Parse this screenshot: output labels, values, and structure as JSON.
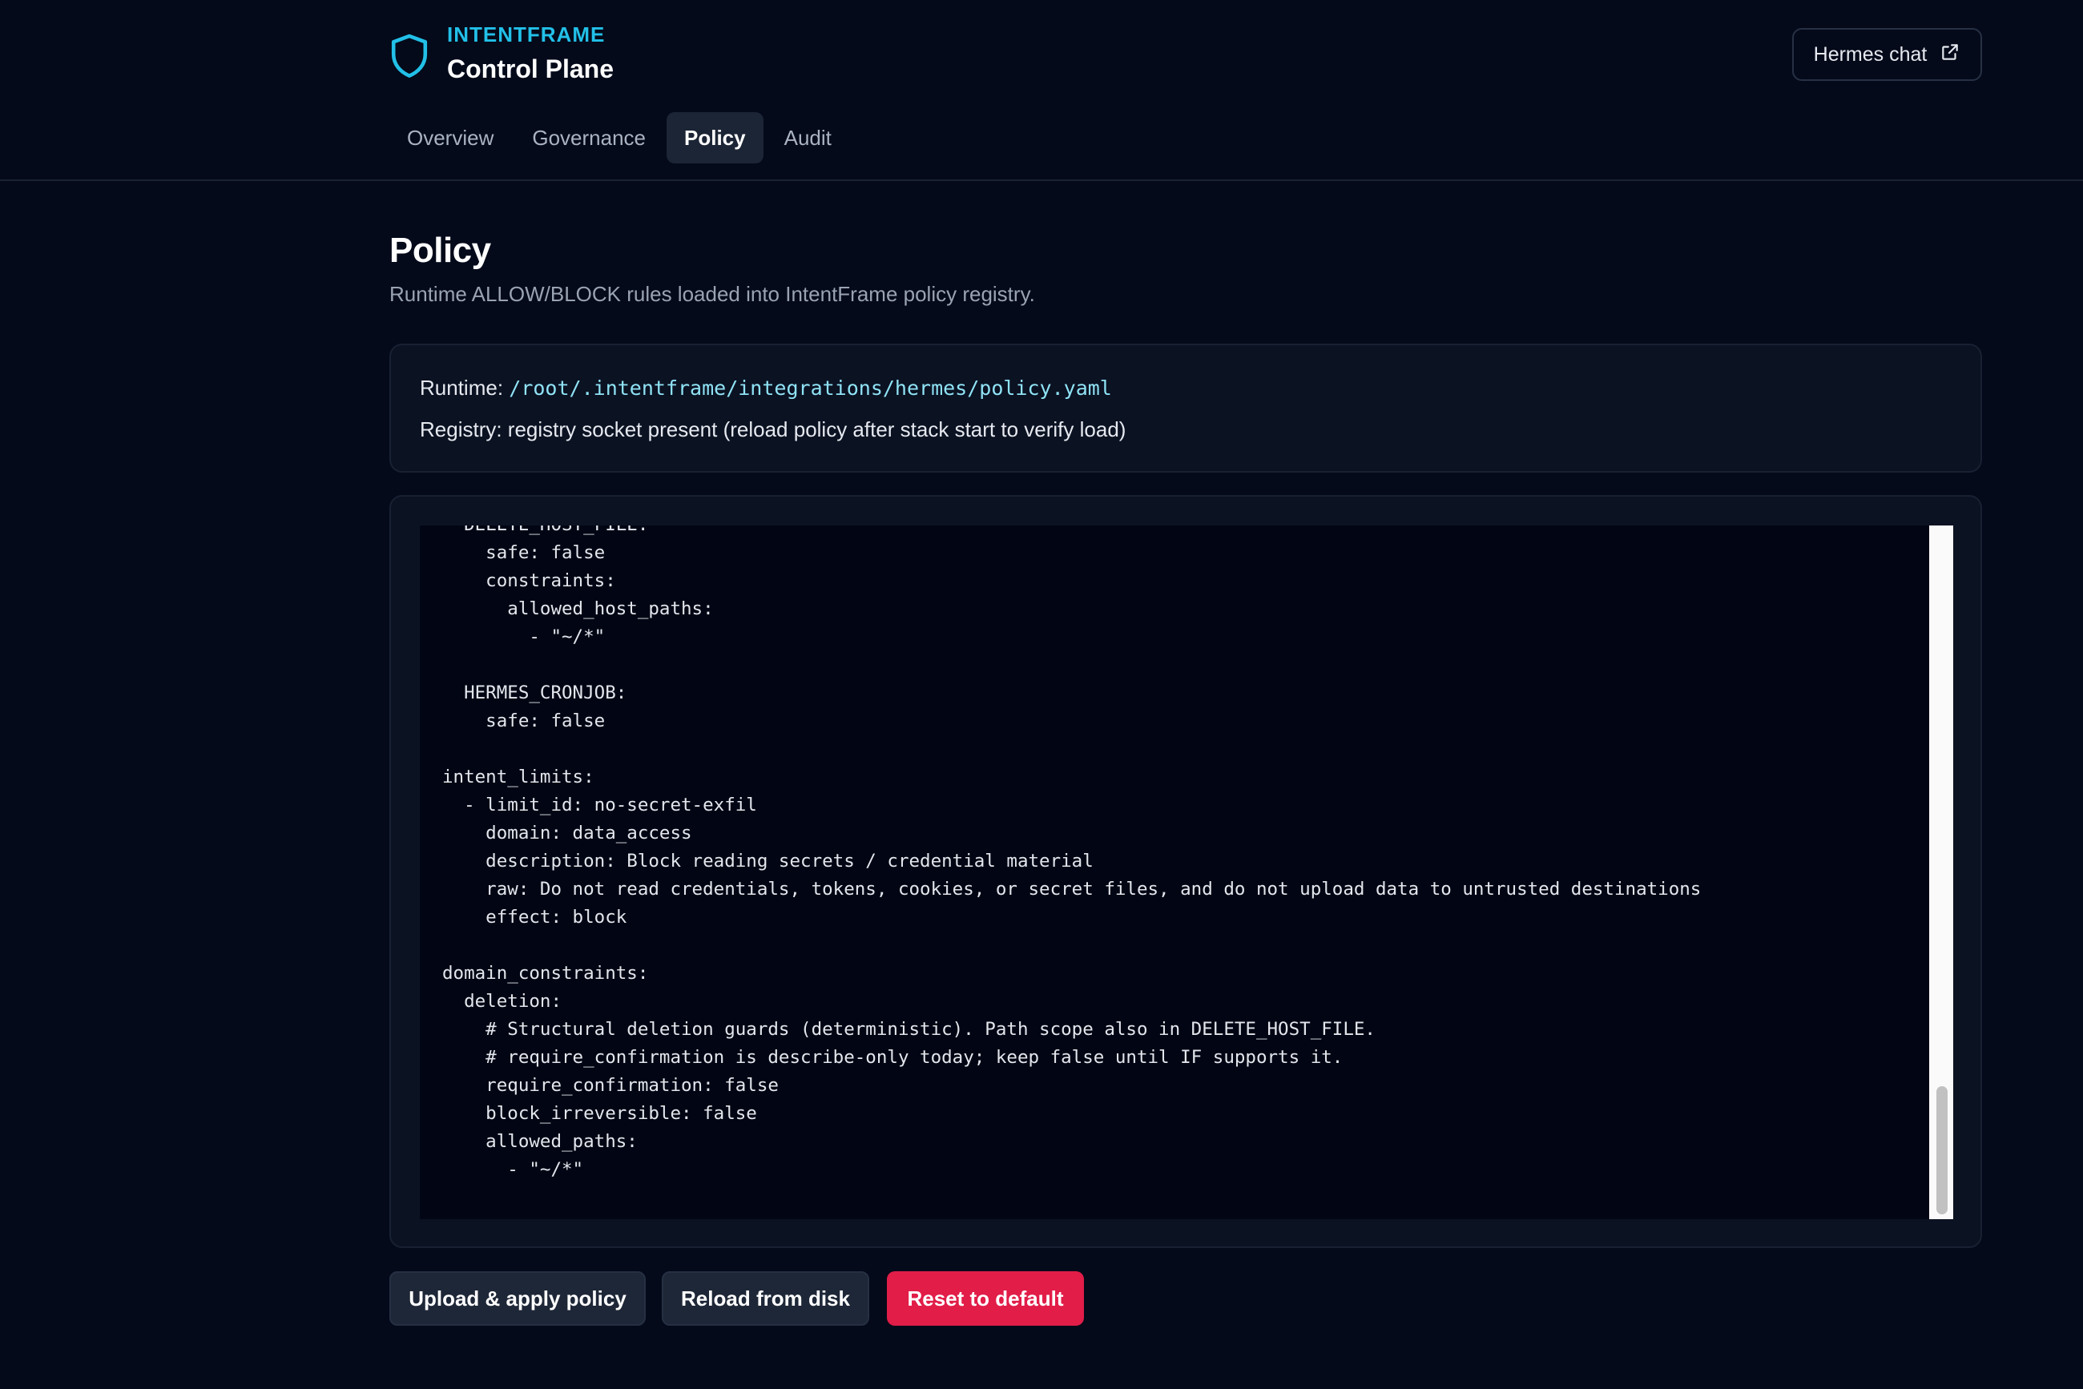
{
  "header": {
    "brand_eyebrow": "INTENTFRAME",
    "brand_title": "Control Plane",
    "hermes_button_label": "Hermes chat",
    "brand_icon": "shield-icon",
    "external_icon": "external-link-icon",
    "accent_color": "#22c0e8"
  },
  "tabs": [
    {
      "label": "Overview",
      "active": false
    },
    {
      "label": "Governance",
      "active": false
    },
    {
      "label": "Policy",
      "active": true
    },
    {
      "label": "Audit",
      "active": false
    }
  ],
  "page": {
    "title": "Policy",
    "subtitle": "Runtime ALLOW/BLOCK rules loaded into IntentFrame policy registry."
  },
  "info": {
    "runtime_label": "Runtime:",
    "runtime_path": "/root/.intentframe/integrations/hermes/policy.yaml",
    "registry_text": "Registry: registry socket present (reload policy after stack start to verify load)"
  },
  "editor": {
    "content": "  DELETE_HOST_FILE:\n    safe: false\n    constraints:\n      allowed_host_paths:\n        - \"~/*\"\n\n  HERMES_CRONJOB:\n    safe: false\n\nintent_limits:\n  - limit_id: no-secret-exfil\n    domain: data_access\n    description: Block reading secrets / credential material\n    raw: Do not read credentials, tokens, cookies, or secret files, and do not upload data to untrusted destinations\n    effect: block\n\ndomain_constraints:\n  deletion:\n    # Structural deletion guards (deterministic). Path scope also in DELETE_HOST_FILE.\n    # require_confirmation is describe-only today; keep false until IF supports it.\n    require_confirmation: false\n    block_irreversible: false\n    allowed_paths:\n      - \"~/*\""
  },
  "actions": {
    "upload_label": "Upload & apply policy",
    "reload_label": "Reload from disk",
    "reset_label": "Reset to default",
    "reset_color": "#e11d48"
  }
}
